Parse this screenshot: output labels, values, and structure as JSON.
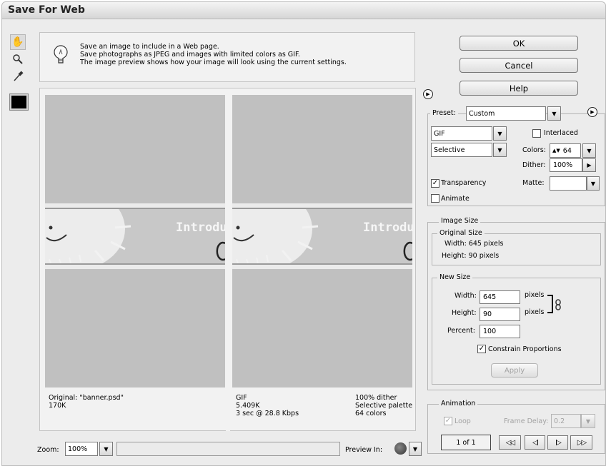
{
  "window": {
    "title": "Save For Web"
  },
  "hints": [
    "Save an image to include in a Web page.",
    "Save photographs as JPEG and images with limited colors as GIF.",
    "The image preview shows how your image will look using the current settings."
  ],
  "preview": {
    "banner_text": "Introdu",
    "original": {
      "line1": "Original: \"banner.psd\"",
      "line2": "170K"
    },
    "optimized": {
      "format": "GIF",
      "size": "5.409K",
      "time": "3 sec @ 28.8 Kbps",
      "dither": "100% dither",
      "palette": "Selective palette",
      "colors": "64 colors"
    }
  },
  "buttons": {
    "ok": "OK",
    "cancel": "Cancel",
    "help": "Help"
  },
  "settings": {
    "preset_label": "Preset:",
    "preset_value": "Custom",
    "format": "GIF",
    "reduction": "Selective",
    "interlaced_label": "Interlaced",
    "interlaced_checked": false,
    "colors_label": "Colors:",
    "colors_value": "64",
    "dither_label": "Dither:",
    "dither_value": "100%",
    "transparency_label": "Transparency",
    "transparency_checked": true,
    "matte_label": "Matte:",
    "matte_value": "",
    "animate_label": "Animate",
    "animate_checked": false
  },
  "image_size": {
    "title": "Image Size",
    "original_title": "Original Size",
    "orig_width": "Width: 645 pixels",
    "orig_height": "Height: 90 pixels",
    "new_title": "New Size",
    "width_label": "Width:",
    "width_value": "645",
    "height_label": "Height:",
    "height_value": "90",
    "unit": "pixels",
    "percent_label": "Percent:",
    "percent_value": "100",
    "constrain_label": "Constrain Proportions",
    "constrain_checked": true,
    "apply_label": "Apply"
  },
  "animation": {
    "title": "Animation",
    "loop_label": "Loop",
    "frame_delay_label": "Frame Delay:",
    "frame_delay_value": "0.2",
    "frame_counter": "1 of 1",
    "nav": [
      "◁◁",
      "◁I",
      "I▷",
      "▷▷"
    ]
  },
  "bottom": {
    "zoom_label": "Zoom:",
    "zoom_value": "100%",
    "preview_in_label": "Preview In:"
  },
  "icons": {
    "hand": "hand-icon",
    "zoom": "zoom-icon",
    "eyedropper": "eyedropper-icon",
    "lightbulb": "lightbulb-icon",
    "browser": "browser-icon"
  }
}
